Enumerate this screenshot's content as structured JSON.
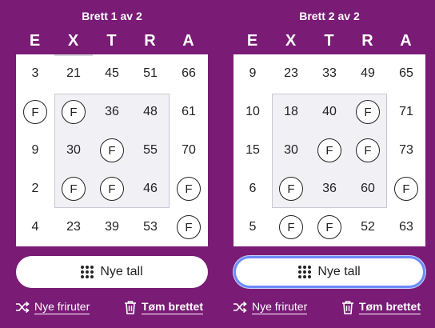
{
  "colors": {
    "background": "#7a1b76",
    "panel": "#ffffff",
    "center_box": "#f1f0f5",
    "focus_ring": "#6b8cff"
  },
  "letters": [
    "E",
    "X",
    "T",
    "R",
    "A"
  ],
  "boards": [
    {
      "title": "Brett 1 av 2",
      "cells": [
        [
          "3",
          "21",
          "45",
          "51",
          "66"
        ],
        [
          "F",
          "F",
          "36",
          "48",
          "61"
        ],
        [
          "9",
          "30",
          "F",
          "55",
          "70"
        ],
        [
          "2",
          "F",
          "F",
          "46",
          "F"
        ],
        [
          "4",
          "23",
          "39",
          "53",
          "F"
        ]
      ],
      "button_label": "Nye tall",
      "button_icon": "grid-dots-icon",
      "shuffle_label": "Nye friruter",
      "shuffle_icon": "shuffle-icon",
      "clear_label": "Tøm brettet",
      "clear_icon": "trash-icon",
      "focused": false
    },
    {
      "title": "Brett 2 av 2",
      "cells": [
        [
          "9",
          "23",
          "33",
          "49",
          "65"
        ],
        [
          "10",
          "18",
          "40",
          "F",
          "71"
        ],
        [
          "15",
          "30",
          "F",
          "F",
          "73"
        ],
        [
          "6",
          "F",
          "36",
          "60",
          "F"
        ],
        [
          "5",
          "F",
          "F",
          "52",
          "63"
        ]
      ],
      "button_label": "Nye tall",
      "button_icon": "grid-dots-icon",
      "shuffle_label": "Nye friruter",
      "shuffle_icon": "shuffle-icon",
      "clear_label": "Tøm brettet",
      "clear_icon": "trash-icon",
      "focused": true
    }
  ]
}
